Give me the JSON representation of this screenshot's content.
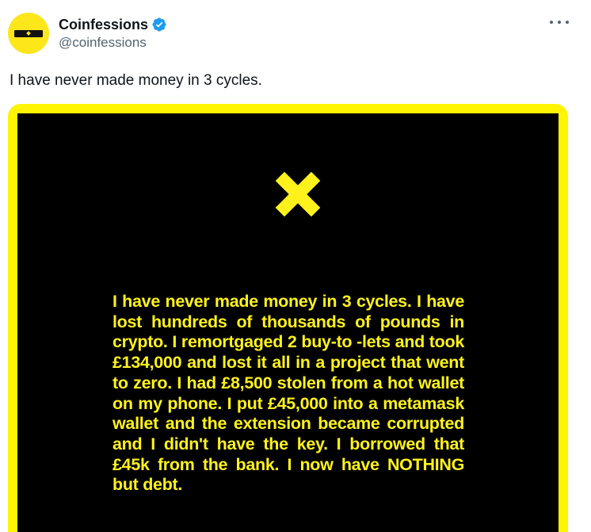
{
  "author": {
    "display_name": "Coinfessions",
    "handle": "@coinfessions",
    "verified": true
  },
  "tweet": {
    "text": "I have never made money in 3 cycles."
  },
  "media": {
    "confession_text": "I have never made money in 3 cycles. I have lost hundreds of thousands of pounds in crypto. I remortgaged 2 buy-to -lets and took £134,000 and lost it all in a project that went to zero. I had £8,500 stolen from a hot wallet on my phone. I put £45,000 into a metamask wallet and the extension became corrupted and I didn't have the key. I borrowed that £45k from the bank. I now have NOTHING but debt.",
    "icon": "x-cross-icon"
  },
  "colors": {
    "brand_yellow": "#fff500",
    "confession_text": "#fff21c",
    "verified_blue": "#1d9bf0",
    "handle_gray": "#536471"
  }
}
